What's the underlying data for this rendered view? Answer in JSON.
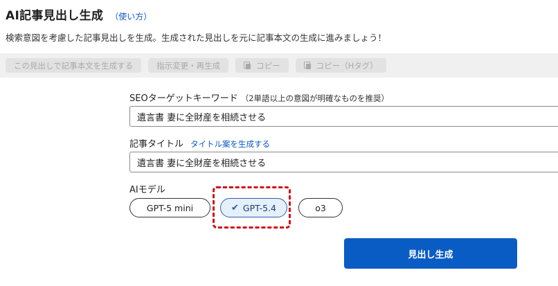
{
  "header": {
    "title": "AI記事見出し生成",
    "help_link": "（使い方）",
    "description": "検索意図を考慮した記事見出しを生成。生成された見出しを元に記事本文の生成に進みましょう！"
  },
  "toolbar": {
    "buttons": [
      {
        "label": "この見出しで記事本文を生成する",
        "icon": null,
        "enabled": false
      },
      {
        "label": "指示変更・再生成",
        "icon": null,
        "enabled": false
      },
      {
        "label": "コピー",
        "icon": "copy-icon",
        "enabled": false
      },
      {
        "label": "コピー（Hタグ）",
        "icon": "copy-icon",
        "enabled": false
      }
    ]
  },
  "form": {
    "keyword": {
      "label": "SEOターゲットキーワード",
      "hint": "（2単語以上の意図が明確なものを推奨）",
      "value": "遺言書 妻に全財産を相続させる"
    },
    "title": {
      "label": "記事タイトル",
      "link": "タイトル案を生成する",
      "value": "遺言書 妻に全財産を相続させる"
    },
    "model": {
      "label": "AIモデル",
      "options": [
        {
          "label": "GPT-5 mini",
          "selected": false
        },
        {
          "label": "GPT-5.4",
          "selected": true
        },
        {
          "label": "o3",
          "selected": false
        }
      ]
    },
    "submit_label": "見出し生成"
  },
  "colors": {
    "primary": "#0a5cc5",
    "link": "#0a58ca",
    "highlight": "#d0101a",
    "selected_bg": "#e6f0fb"
  }
}
